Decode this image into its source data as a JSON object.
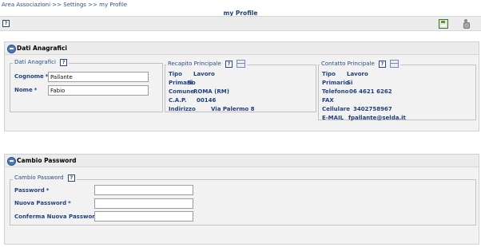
{
  "breadcrumb": "Area Associazioni >> Settings >> my Profile",
  "page_title": "my Profile",
  "toolbar": {
    "help_label": "?",
    "save_icon": "save-icon",
    "exit_icon": "exit-icon"
  },
  "anagrafici": {
    "panel_title": "Dati Anagrafici",
    "section_label": "Dati Anagrafici",
    "cognome_label": "Cognome",
    "cognome_value": "Pallante",
    "nome_label": "Nome",
    "nome_value": "Fabio",
    "required_mark": "*"
  },
  "recapito": {
    "label": "Recapito Principale",
    "rows": [
      {
        "k": "Tipo",
        "v": "Lavoro"
      },
      {
        "k": "Primario",
        "v": "Si"
      },
      {
        "k": "Comune",
        "v": "ROMA    (RM)"
      },
      {
        "k": "C.A.P.",
        "v": "00146"
      },
      {
        "k": "Indirizzo",
        "v": "Via Palermo 8"
      }
    ]
  },
  "contatto": {
    "label": "Contatto Principale",
    "rows": [
      {
        "k": "Tipo",
        "v": "Lavoro"
      },
      {
        "k": "Primario",
        "v": "Si"
      },
      {
        "k": "Telefono",
        "v": "06 4621 6262"
      },
      {
        "k": "FAX",
        "v": ""
      },
      {
        "k": "Cellulare",
        "v": "3402758967"
      },
      {
        "k": "E-MAIL",
        "v": "fpallante@selda.it"
      }
    ]
  },
  "password": {
    "panel_title": "Cambio Password",
    "section_label": "Cambio Password",
    "password_label": "Password",
    "new_password_label": "Nuova Password",
    "confirm_password_label": "Conferma Nuova Password",
    "password_value": "",
    "new_password_value": "",
    "confirm_password_value": "",
    "required_mark": "*"
  },
  "help_label": "?"
}
